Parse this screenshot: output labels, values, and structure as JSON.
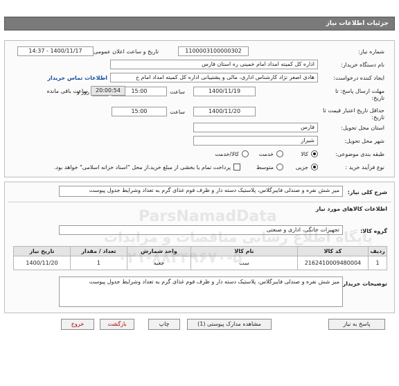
{
  "header": {
    "title": "جزئیات اطلاعات نیاز"
  },
  "form": {
    "need_number_label": "شماره نیاز:",
    "need_number": "1100003100000302",
    "announce_label": "تاریخ و ساعت اعلان عمومی:",
    "announce_value": "1400/11/17 - 14:37",
    "buyer_label": "نام دستگاه خریدار:",
    "buyer_value": "اداره کل کمیته امداد امام خمینی  ره  استان فارس",
    "creator_label": "ایجاد کننده درخواست:",
    "creator_value": "هادی اصغر نژاد کارشناس اداری، مالی و پشتیبانی اداره کل کمیته امداد امام خ",
    "contact_link": "اطلاعات تماس خریدار",
    "deadline_label": "مهلت ارسال پاسخ: تا تاریخ:",
    "deadline_date": "1400/11/19",
    "time_label": "ساعت",
    "deadline_time": "15:00",
    "days_value": "1",
    "days_label": "روز و",
    "remaining_value": "20:00:54",
    "remaining_label": "ساعت باقی مانده",
    "validity_label": "حداقل تاریخ اعتبار قیمت تا تاریخ:",
    "validity_date": "1400/11/20",
    "validity_time_label": "ساعت",
    "validity_time": "15:00",
    "province_label": "استان محل تحویل:",
    "province_value": "فارس",
    "city_label": "شهر محل تحویل:",
    "city_value": "شیراز",
    "category_label": "طبقه بندی موضوعی:",
    "category_options": [
      "کالا",
      "خدمت",
      "کالا/خدمت"
    ],
    "category_selected": "کالا",
    "process_label": "نوع فرآیند خرید :",
    "process_options": [
      "جزیی",
      "متوسط"
    ],
    "process_selected": "جزیی",
    "payment_note": "پرداخت تمام یا بخشی از مبلغ خرید،از محل \"اسناد خزانه اسلامی\" خواهد بود."
  },
  "need_summary": {
    "label": "شرح کلی نیاز:",
    "value": "میز شش نفره و صندلی فایبرگلاس، پلاستیک دسته دار و ظرف فوم غذای گرم به تعداد وشرایط جدول پیوست"
  },
  "goods": {
    "section_title": "اطلاعات کالاهای مورد نیاز",
    "group_label": "گروه کالا:",
    "group_value": "تجهیزات خانگی، اداری و صنعتی",
    "table": {
      "headers": [
        "ردیف",
        "کد کالا",
        "نام کالا",
        "واحد شمارش",
        "تعداد / مقدار",
        "تاریخ نیاز"
      ],
      "rows": [
        {
          "row": "1",
          "code": "2162410009480004",
          "name": "ست",
          "unit": "جعبه",
          "qty": "1",
          "date": "1400/11/20"
        }
      ]
    }
  },
  "buyer_notes": {
    "label": "توضیحات خریدار:",
    "value": "میز شش نفره و صندلی فایبرگلاس، پلاستیک دسته دار و ظرف فوم غذای گرم به تعداد وشرایط جدول پیوست"
  },
  "buttons": {
    "reply": "پاسخ به نیاز",
    "attachments": "مشاهده مدارک پیوستی (1)",
    "print": "چاپ",
    "back": "بازگشت",
    "exit": "خروج"
  },
  "watermark": {
    "line1": "ParsNamadData",
    "line2": "پایگاه اطلاع رسانی مناقصات و مزایدات",
    "line3": "۰۲۱-۸۸۳۴۹۶۷۰-۵"
  }
}
